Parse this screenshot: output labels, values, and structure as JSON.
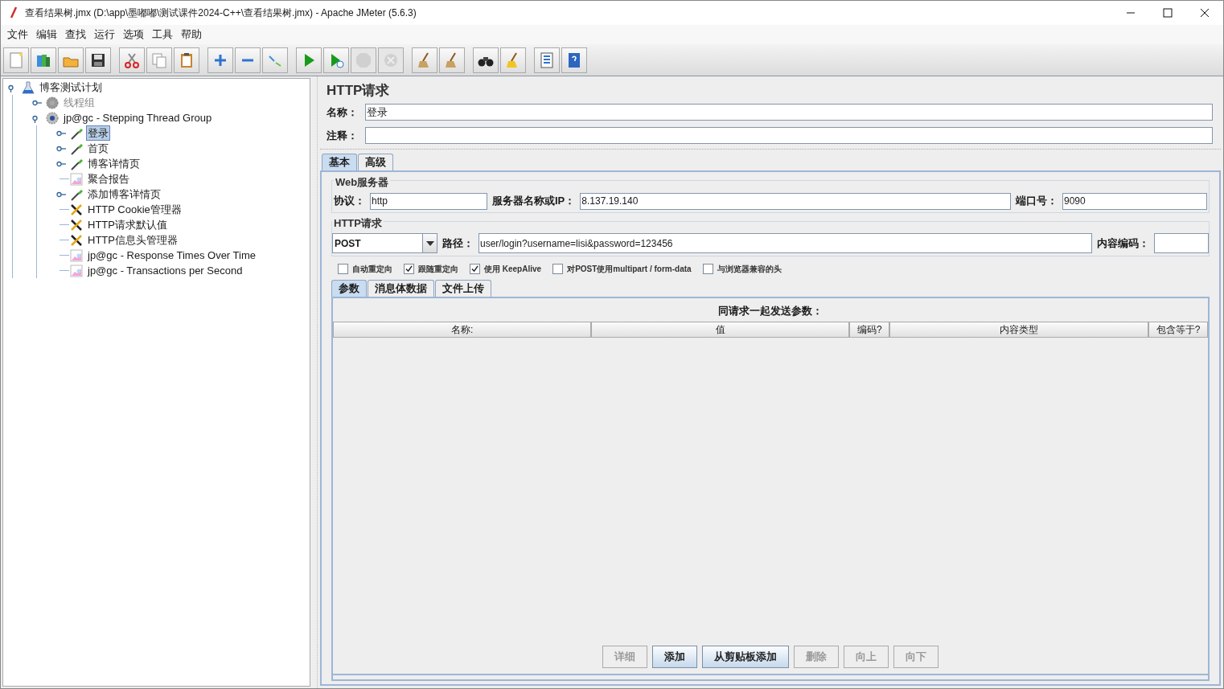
{
  "window": {
    "title": "查看结果树.jmx (D:\\app\\墨嘟嘟\\测试课件2024-C++\\查看结果树.jmx) - Apache JMeter (5.6.3)"
  },
  "menu": [
    "文件",
    "编辑",
    "查找",
    "运行",
    "选项",
    "工具",
    "帮助"
  ],
  "toolbar_groups": [
    [
      {
        "kind": "new",
        "disabled": false
      },
      {
        "kind": "templates",
        "disabled": false
      },
      {
        "kind": "open",
        "disabled": false
      },
      {
        "kind": "save",
        "disabled": false
      }
    ],
    [
      {
        "kind": "cut",
        "disabled": false
      },
      {
        "kind": "copy",
        "disabled": false
      },
      {
        "kind": "paste",
        "disabled": false
      }
    ],
    [
      {
        "kind": "expand",
        "disabled": false
      },
      {
        "kind": "collapse",
        "disabled": false
      },
      {
        "kind": "toggle",
        "disabled": false
      }
    ],
    [
      {
        "kind": "start",
        "disabled": false
      },
      {
        "kind": "start-no-pause",
        "disabled": false
      },
      {
        "kind": "stop",
        "disabled": true
      },
      {
        "kind": "shutdown",
        "disabled": true
      }
    ],
    [
      {
        "kind": "clear",
        "disabled": false
      },
      {
        "kind": "clear-all",
        "disabled": false
      }
    ],
    [
      {
        "kind": "search",
        "disabled": false
      },
      {
        "kind": "reset-search",
        "disabled": false
      }
    ],
    [
      {
        "kind": "log",
        "disabled": false
      },
      {
        "kind": "help",
        "disabled": false
      }
    ]
  ],
  "tree": {
    "label": "博客测试计划",
    "kind": "plan",
    "selected": false,
    "disabled": false,
    "expanded": true,
    "children": [
      {
        "label": "线程组",
        "kind": "thread-group",
        "selected": false,
        "disabled": true,
        "expanded": false
      },
      {
        "label": "jp@gc - Stepping Thread Group",
        "kind": "thread-group",
        "selected": false,
        "disabled": false,
        "expanded": true,
        "children": [
          {
            "label": "登录",
            "kind": "sampler",
            "selected": true,
            "disabled": false,
            "expanded": false
          },
          {
            "label": "首页",
            "kind": "sampler",
            "selected": false,
            "disabled": false,
            "expanded": false
          },
          {
            "label": "博客详情页",
            "kind": "sampler",
            "selected": false,
            "disabled": false,
            "expanded": false
          },
          {
            "label": "聚合报告",
            "kind": "listener",
            "selected": false,
            "disabled": false
          },
          {
            "label": "添加博客详情页",
            "kind": "sampler",
            "selected": false,
            "disabled": false,
            "expanded": false
          },
          {
            "label": "HTTP Cookie管理器",
            "kind": "config",
            "selected": false,
            "disabled": false
          },
          {
            "label": "HTTP请求默认值",
            "kind": "config",
            "selected": false,
            "disabled": false
          },
          {
            "label": "HTTP信息头管理器",
            "kind": "config",
            "selected": false,
            "disabled": false
          },
          {
            "label": "jp@gc - Response Times Over Time",
            "kind": "listener",
            "selected": false,
            "disabled": false
          },
          {
            "label": "jp@gc - Transactions per Second",
            "kind": "listener",
            "selected": false,
            "disabled": false
          }
        ]
      }
    ]
  },
  "editor": {
    "title": "HTTP请求",
    "name": {
      "label": "名称：",
      "value": "登录"
    },
    "comment": {
      "label": "注释："
    },
    "tabs": [
      {
        "label": "基本",
        "selected": true
      },
      {
        "label": "高级",
        "selected": false
      }
    ],
    "web_server": {
      "legend": "Web服务器",
      "protocol": {
        "label": "协议：",
        "value": "http"
      },
      "server": {
        "label": "服务器名称或IP：",
        "value": "8.137.19.140"
      },
      "port": {
        "label": "端口号：",
        "value": "9090"
      }
    },
    "http_request": {
      "legend": "HTTP请求",
      "method": "POST",
      "path": {
        "label": "路径：",
        "value": "user/login?username=lisi&password=123456"
      },
      "encoding": {
        "label": "内容编码："
      }
    },
    "options": [
      {
        "label": "自动重定向",
        "checked": false
      },
      {
        "label": "跟随重定向",
        "checked": true
      },
      {
        "label": "使用 KeepAlive",
        "checked": true
      },
      {
        "label": "对POST使用multipart / form-data",
        "checked": false
      },
      {
        "label": "与浏览器兼容的头",
        "checked": false
      }
    ],
    "param_tabs": [
      {
        "label": "参数",
        "selected": true
      },
      {
        "label": "消息体数据",
        "selected": false
      },
      {
        "label": "文件上传",
        "selected": false
      }
    ],
    "table": {
      "title": "同请求一起发送参数：",
      "columns": [
        "名称:",
        "值",
        "编码?",
        "内容类型",
        "包含等于?"
      ]
    },
    "buttons": [
      {
        "label": "详细",
        "disabled": true
      },
      {
        "label": "添加",
        "disabled": false
      },
      {
        "label": "从剪贴板添加",
        "disabled": false
      },
      {
        "label": "删除",
        "disabled": true
      },
      {
        "label": "向上",
        "disabled": true
      },
      {
        "label": "向下",
        "disabled": true
      }
    ]
  }
}
